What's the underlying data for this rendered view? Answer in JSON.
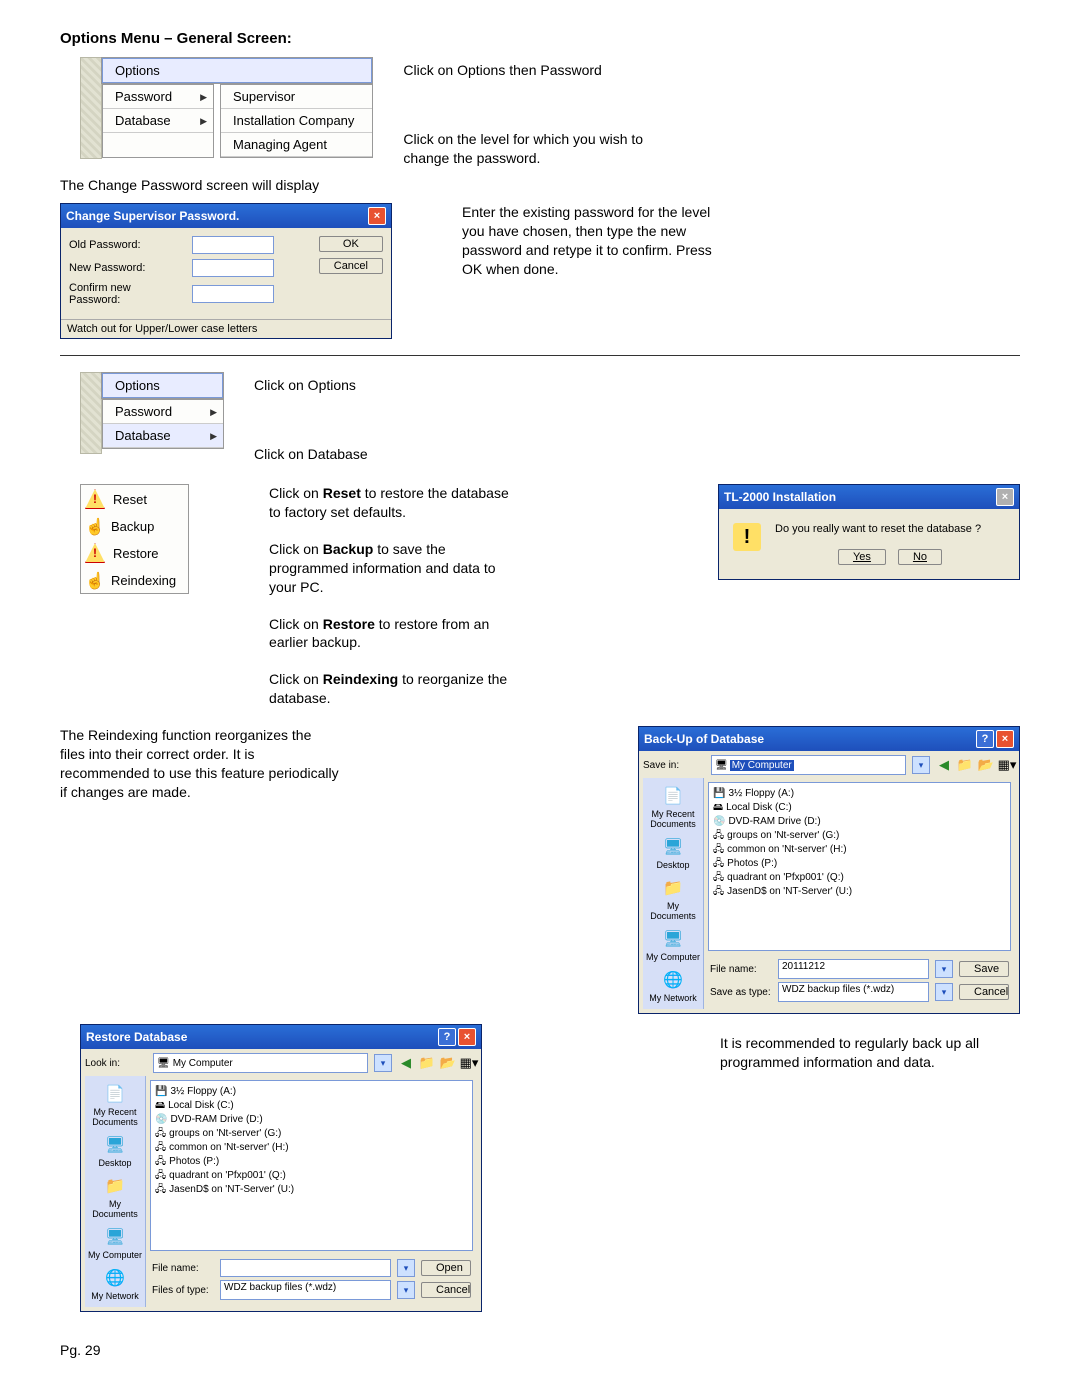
{
  "title": "Options Menu – General Screen:",
  "menu1": {
    "header": "Options",
    "items": [
      "Password",
      "Database"
    ],
    "sub": [
      "Supervisor",
      "Installation Company",
      "Managing Agent"
    ]
  },
  "text1": "Click on Options then Password",
  "text2": "Click on the level for which you wish to change the password.",
  "text3": "The Change Password screen will display",
  "dlg1": {
    "title": "Change Supervisor Password.",
    "old": "Old Password:",
    "new": "New Password:",
    "confirm": "Confirm new Password:",
    "ok": "OK",
    "cancel": "Cancel",
    "status": "Watch out for Upper/Lower case letters"
  },
  "text4": "Enter the existing password for the level you have chosen, then type the new password and retype it to confirm.  Press OK when done.",
  "text5": "Click on Options",
  "text6": "Click on Database",
  "db_items": {
    "reset": "Reset",
    "backup": "Backup",
    "restore": "Restore",
    "reindex": "Reindexing"
  },
  "text_reset_a": "Click on ",
  "text_reset_b": "Reset",
  "text_reset_c": " to restore the database to factory set defaults.",
  "text_backup_a": "Click on ",
  "text_backup_b": "Backup",
  "text_backup_c": " to save the programmed information and data to your PC.",
  "text_restore_a": "Click on ",
  "text_restore_b": "Restore",
  "text_restore_c": " to restore from an earlier backup.",
  "text_reindex_a": "Click on ",
  "text_reindex_b": "Reindexing",
  "text_reindex_c": " to reorganize the database.",
  "text7": "The Reindexing function reorganizes the files into their correct order.  It is recommended to use this feature periodically if changes are made.",
  "msg": {
    "title": "TL-2000 Installation",
    "text": "Do you really want to reset the database ?",
    "yes": "Yes",
    "no": "No"
  },
  "savedlg": {
    "title": "Back-Up of Database",
    "savein_lbl": "Save in:",
    "savein_val": "My Computer",
    "filename_lbl": "File name:",
    "filename_val": "20111212",
    "type_lbl": "Save as type:",
    "type_val": "WDZ backup files (*.wdz)",
    "save": "Save",
    "cancel": "Cancel",
    "drives": [
      "3½ Floppy (A:)",
      "Local Disk (C:)",
      "DVD-RAM Drive (D:)",
      "groups on 'Nt-server' (G:)",
      "common on 'Nt-server' (H:)",
      "Photos (P:)",
      "quadrant on 'Pfxp001' (Q:)",
      "JasenD$ on 'NT-Server' (U:)"
    ],
    "places": [
      "My Recent Documents",
      "Desktop",
      "My Documents",
      "My Computer",
      "My Network"
    ]
  },
  "opendlg": {
    "title": "Restore Database",
    "lookin_lbl": "Look in:",
    "lookin_val": "My Computer",
    "filename_lbl": "File name:",
    "filename_val": "",
    "type_lbl": "Files of type:",
    "type_val": "WDZ backup files (*.wdz)",
    "open": "Open",
    "cancel": "Cancel",
    "drives": [
      "3½ Floppy (A:)",
      "Local Disk (C:)",
      "DVD-RAM Drive (D:)",
      "groups on 'Nt-server' (G:)",
      "common on 'Nt-server' (H:)",
      "Photos (P:)",
      "quadrant on 'Pfxp001' (Q:)",
      "JasenD$ on 'NT-Server' (U:)"
    ],
    "places": [
      "My Recent Documents",
      "Desktop",
      "My Documents",
      "My Computer",
      "My Network"
    ]
  },
  "text8": "It is recommended to regularly back up all programmed information and data.",
  "pg": "Pg. 29"
}
